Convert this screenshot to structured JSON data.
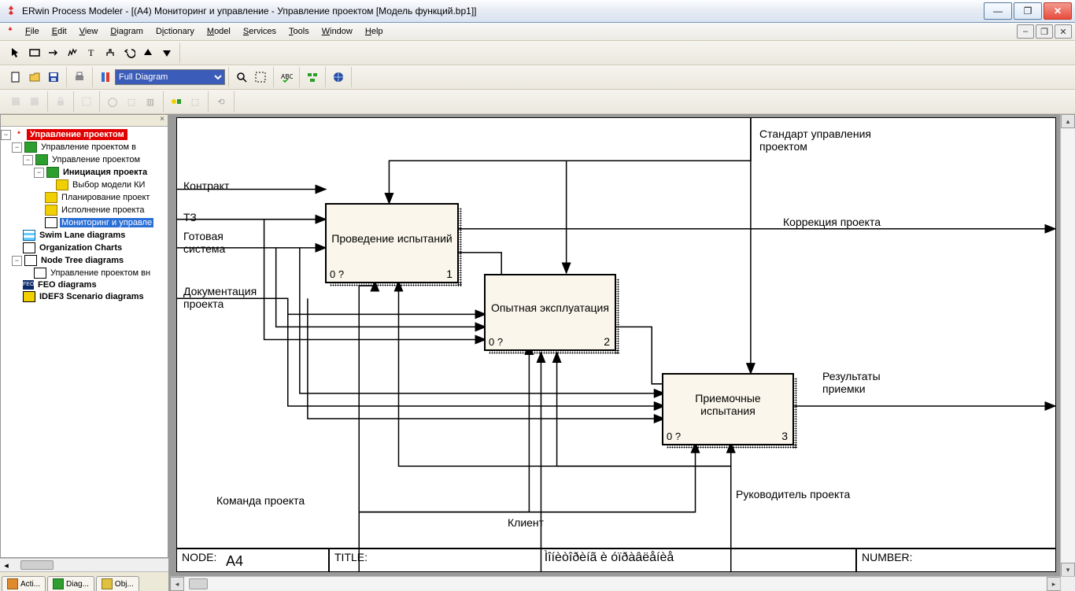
{
  "window": {
    "title": "ERwin Process Modeler - [(A4) Мониторинг и управление - Управление проектом  [Модель функций.bp1]]"
  },
  "menus": [
    "File",
    "Edit",
    "View",
    "Diagram",
    "Dictionary",
    "Model",
    "Services",
    "Tools",
    "Window",
    "Help"
  ],
  "zoom_selector": "Full Diagram",
  "tree": {
    "root": "Управление проектом",
    "n1": "Управление проектом в",
    "n2": "Управление проектом",
    "n3": "Инициация проекта",
    "n4": "Выбор модели  КИ",
    "n5": "Планирование проект",
    "n6": "Исполнение проекта",
    "n7": "Мониторинг и управле",
    "n8": "Swim Lane diagrams",
    "n9": "Organization Charts",
    "n10": "Node Tree diagrams",
    "n11": "Управление проектом вн",
    "n12": "FEO diagrams",
    "n13": "IDEF3 Scenario diagrams"
  },
  "sidetabs": {
    "t1": "Acti...",
    "t2": "Diag...",
    "t3": "Obj..."
  },
  "diagram": {
    "control1": "Стандарт управления проектом",
    "in1": "Контракт",
    "in2": "ТЗ",
    "in3": "Готовая система",
    "in4": "Документация проекта",
    "mech1": "Команда проекта",
    "mech2": "Клиент",
    "mech3": "Руководитель проекта",
    "out1": "Коррекция проекта",
    "out2": "Результаты приемки",
    "box1": {
      "title": "Проведение испытаний",
      "id": "0 ?",
      "num": "1"
    },
    "box2": {
      "title": "Опытная эксплуатация",
      "id": "0 ?",
      "num": "2"
    },
    "box3": {
      "title": "Приемочные испытания",
      "id": "0 ?",
      "num": "3"
    }
  },
  "footer": {
    "node_label": "NODE:",
    "node_value": "A4",
    "title_label": "TITLE:",
    "title_value": "Ìîíèòîðèíã è óïðàâëåíèå",
    "number_label": "NUMBER:"
  },
  "chart_data": {
    "type": "diagram",
    "notation": "IDEF0",
    "activities": [
      {
        "id": "1",
        "name": "Проведение испытаний",
        "prefix": "0 ?"
      },
      {
        "id": "2",
        "name": "Опытная эксплуатация",
        "prefix": "0 ?"
      },
      {
        "id": "3",
        "name": "Приемочные испытания",
        "prefix": "0 ?"
      }
    ],
    "inputs": [
      "Контракт",
      "ТЗ",
      "Готовая система",
      "Документация проекта"
    ],
    "controls": [
      "Стандарт управления проектом"
    ],
    "mechanisms": [
      "Команда проекта",
      "Клиент",
      "Руководитель проекта"
    ],
    "outputs": [
      "Коррекция проекта",
      "Результаты приемки"
    ],
    "title": "Ìîíèòîðèíã è óïðàâëåíèå",
    "node": "A4"
  }
}
